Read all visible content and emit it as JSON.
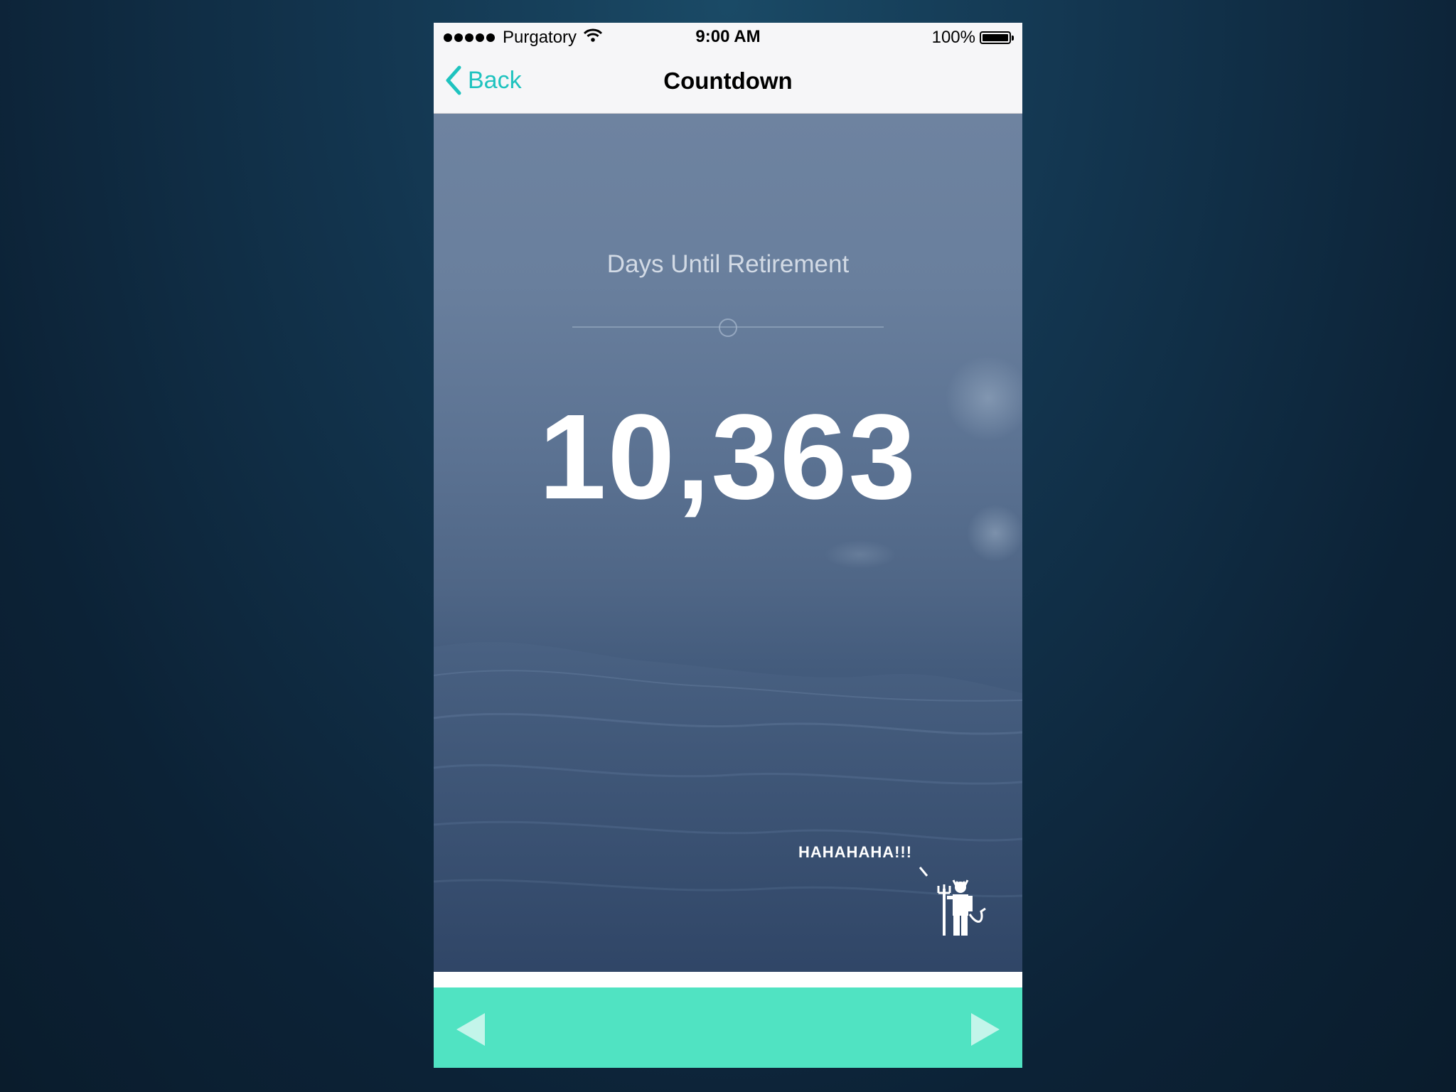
{
  "status_bar": {
    "carrier": "Purgatory",
    "time": "9:00 AM",
    "battery": "100%",
    "signal_icon": "signal-dots-icon",
    "wifi_icon": "wifi-icon",
    "battery_icon": "battery-icon"
  },
  "nav": {
    "back_label": "Back",
    "title": "Countdown",
    "accent_color": "#1fc3bf"
  },
  "countdown": {
    "subtitle": "Days Until Retirement",
    "value": "10,363",
    "slider_position": 0.5
  },
  "mascot": {
    "speech": "HAHAHAHA!!!",
    "icon": "devil-pitchfork-icon"
  },
  "footer": {
    "color": "#50e3c2",
    "prev_icon": "triangle-left-icon",
    "next_icon": "triangle-right-icon"
  }
}
